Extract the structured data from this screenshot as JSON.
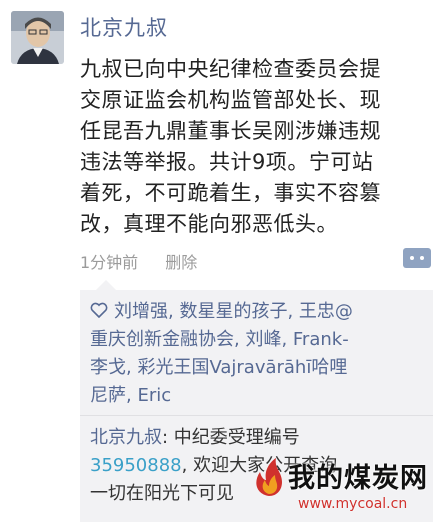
{
  "post": {
    "author": "北京九叔",
    "lines": [
      "九叔已向中央纪律检查委员会提",
      "交原证监会机构监管部处长、现",
      "任昆吾九鼎董事长吴刚涉嫌违规",
      "违法等举报。共计9项。宁可站",
      "着死，不可跪着生，事实不容篡",
      "改，真理不能向邪恶低头。"
    ],
    "time": "1分钟前",
    "delete_label": "删除"
  },
  "likes": {
    "lines": [
      "刘增强, 数星星的孩子, 王忠@",
      "重庆创新金融协会, 刘峰, Frank-",
      "李戈, 彩光王国Vajravārāhī哈哩",
      "尼萨, Eric"
    ]
  },
  "comment": {
    "author": "北京九叔",
    "text_1": ": 中纪委受理编号",
    "number": "35950888",
    "text_2": ", 欢迎大家公开查询",
    "text_3": "一切在阳光下可见"
  },
  "watermark": {
    "title": "我的煤炭网",
    "url": "www.mycoal.cn"
  },
  "colors": {
    "link": "#566993",
    "number": "#3aa0c8",
    "panel": "#f2f2f4",
    "watermark_red": "#d0312d"
  }
}
